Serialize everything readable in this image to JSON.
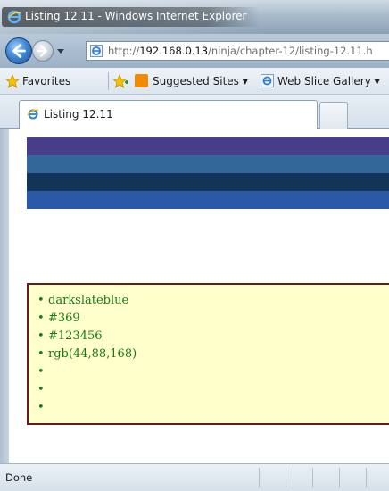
{
  "window": {
    "title": "Listing 12.11 - Windows Internet Explorer"
  },
  "address_bar": {
    "prefix": "http://",
    "host": "192.168.0.13",
    "path": "/ninja/chapter-12/listing-12.11.h"
  },
  "favorites_bar": {
    "favorites_label": "Favorites",
    "suggested_sites_label": "Suggested Sites ▾",
    "web_slice_label": "Web Slice Gallery ▾"
  },
  "tabs": [
    {
      "label": "Listing 12.11"
    }
  ],
  "page": {
    "stripes": [
      {
        "color": "#483d8b"
      },
      {
        "color": "#336699"
      },
      {
        "color": "#123456"
      },
      {
        "color": "#2c58a8"
      }
    ],
    "list_items": [
      "darkslateblue",
      "#369",
      "#123456",
      "rgb(44,88,168)",
      "",
      "",
      ""
    ]
  },
  "status_bar": {
    "text": "Done"
  },
  "colors": {
    "list_background": "#ffffcc",
    "list_border": "#6b1a1a",
    "list_text": "#177a17"
  }
}
